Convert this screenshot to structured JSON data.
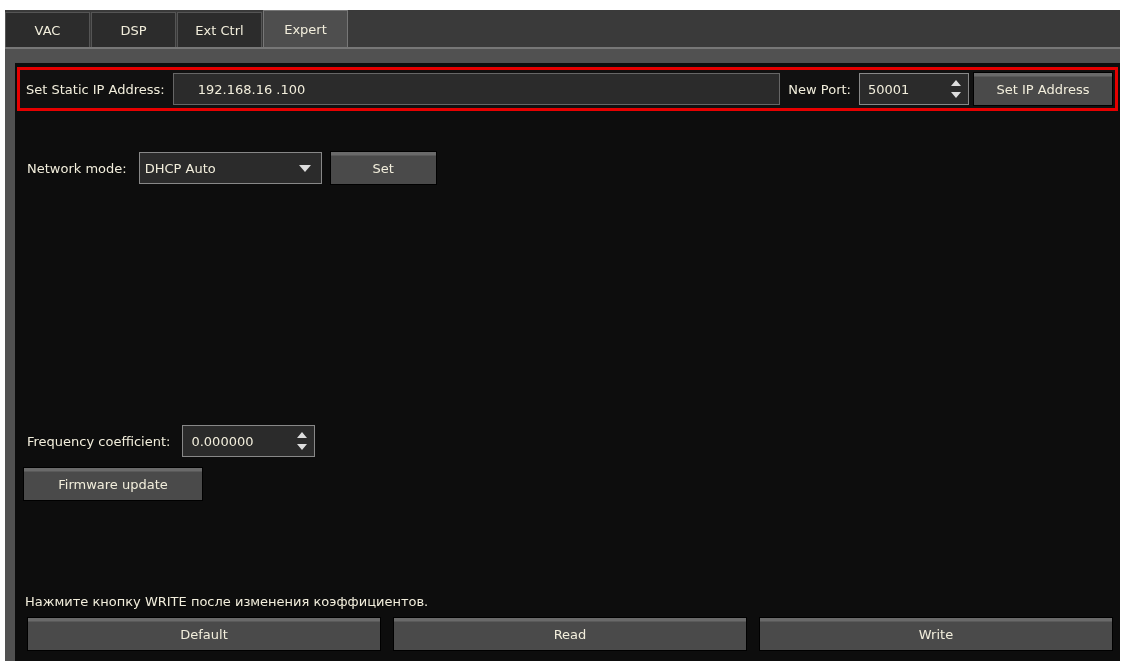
{
  "tabs": [
    {
      "label": "VAC",
      "selected": false
    },
    {
      "label": "DSP",
      "selected": false
    },
    {
      "label": "Ext Ctrl",
      "selected": false
    },
    {
      "label": "Expert",
      "selected": true
    }
  ],
  "static_ip": {
    "label": "Set Static IP Address:",
    "value": "192.168.16 .100"
  },
  "port": {
    "label": "New Port:",
    "value": "50001"
  },
  "set_ip_button": "Set IP Address",
  "network_mode": {
    "label": "Network mode:",
    "value": "DHCP Auto"
  },
  "set_button": "Set",
  "frequency": {
    "label": "Frequency coefficient:",
    "value": "0.000000"
  },
  "firmware_button": "Firmware update",
  "note": "Нажмите кнопку WRITE после изменения коэффициентов.",
  "buttons": [
    "Default",
    "Read",
    "Write"
  ]
}
